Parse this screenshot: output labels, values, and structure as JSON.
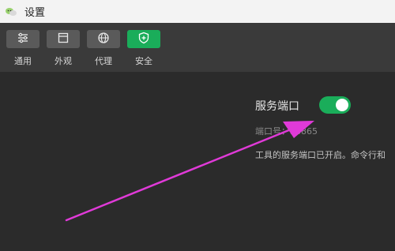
{
  "window": {
    "title": "设置"
  },
  "toolbar": {
    "items": [
      {
        "label": "通用",
        "icon": "sliders-icon",
        "active": false
      },
      {
        "label": "外观",
        "icon": "window-icon",
        "active": false
      },
      {
        "label": "代理",
        "icon": "globe-icon",
        "active": false
      },
      {
        "label": "安全",
        "icon": "shield-plus-icon",
        "active": true
      }
    ]
  },
  "security": {
    "service_port_label": "服务端口",
    "service_port_enabled": true,
    "port_number_text": "端口号：58865",
    "description": "工具的服务端口已开启。命令行和"
  },
  "colors": {
    "accent": "#1aad5a",
    "annotation_arrow": "#e03ad8"
  }
}
